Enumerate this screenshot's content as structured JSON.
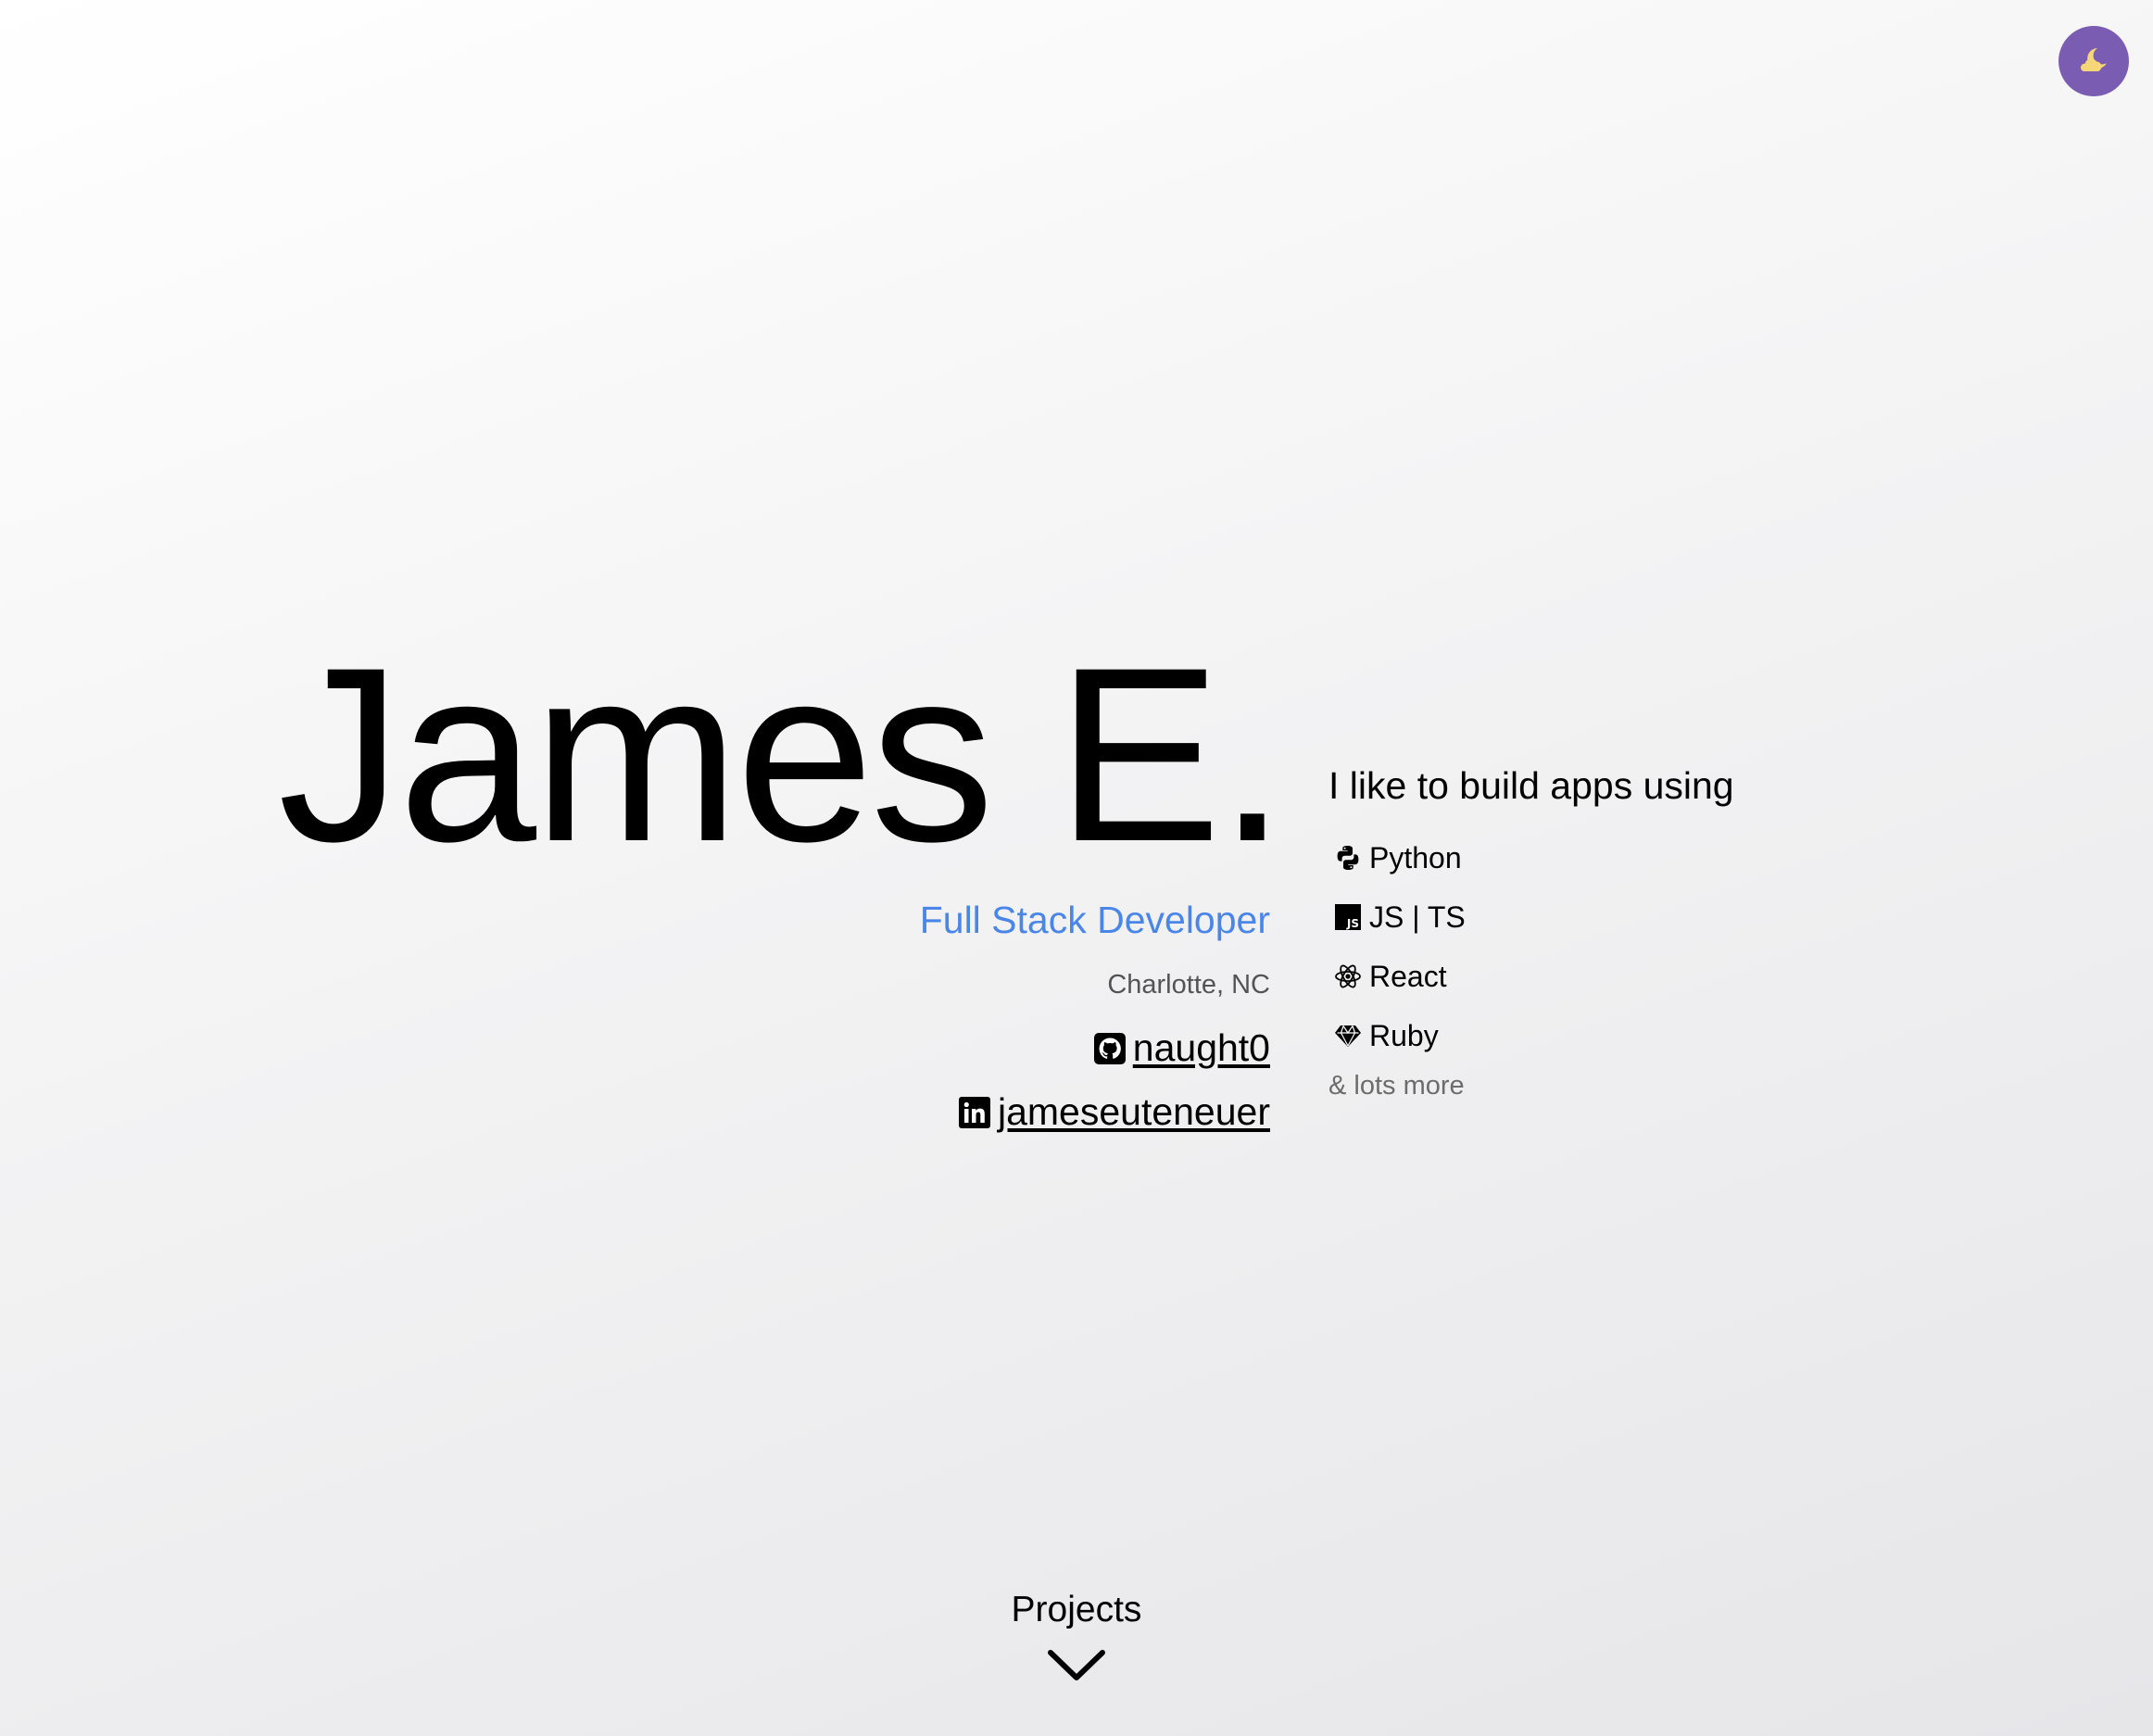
{
  "theme_toggle": {
    "icon": "moon-cloud-icon",
    "bg_color": "#7a5cb3",
    "icon_color": "#f6d777"
  },
  "hero": {
    "name": "James E.",
    "role": "Full Stack Developer",
    "role_color": "#4a86e8",
    "location": "Charlotte, NC",
    "socials": [
      {
        "icon": "github-icon",
        "label": "naught0"
      },
      {
        "icon": "linkedin-icon",
        "label": "jameseuteneuer"
      }
    ]
  },
  "skills": {
    "intro": "I like to build apps using",
    "items": [
      {
        "icon": "python-icon",
        "label": "Python"
      },
      {
        "icon": "javascript-icon",
        "label": "JS | TS"
      },
      {
        "icon": "react-icon",
        "label": "React"
      },
      {
        "icon": "ruby-icon",
        "label": "Ruby"
      }
    ],
    "more": "& lots more"
  },
  "projects": {
    "label": "Projects",
    "icon": "chevron-down-icon"
  }
}
